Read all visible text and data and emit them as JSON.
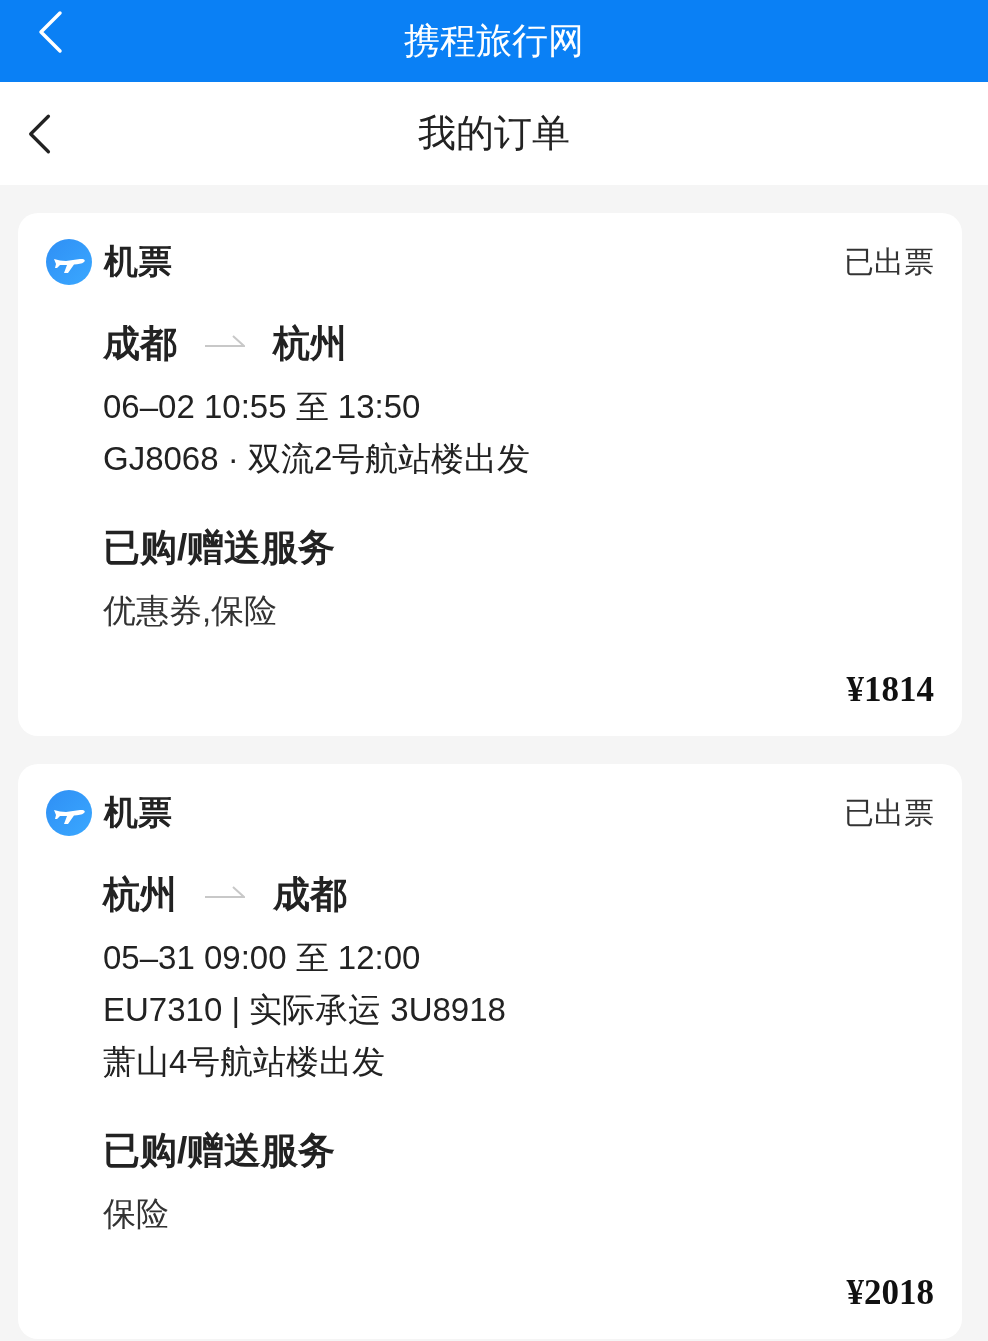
{
  "top_bar": {
    "title": "携程旅行网"
  },
  "header": {
    "title": "我的订单"
  },
  "orders": [
    {
      "category": "机票",
      "status": "已出票",
      "from": "成都",
      "to": "杭州",
      "details": [
        "06–02 10:55 至 13:50",
        "GJ8068 · 双流2号航站楼出发"
      ],
      "services_title": "已购/赠送服务",
      "services": "优惠券,保险",
      "price": "¥1814"
    },
    {
      "category": "机票",
      "status": "已出票",
      "from": "杭州",
      "to": "成都",
      "details": [
        "05–31 09:00 至 12:00",
        "EU7310 | 实际承运 3U8918",
        "萧山4号航站楼出发"
      ],
      "services_title": "已购/赠送服务",
      "services": "保险",
      "price": "¥2018"
    }
  ]
}
